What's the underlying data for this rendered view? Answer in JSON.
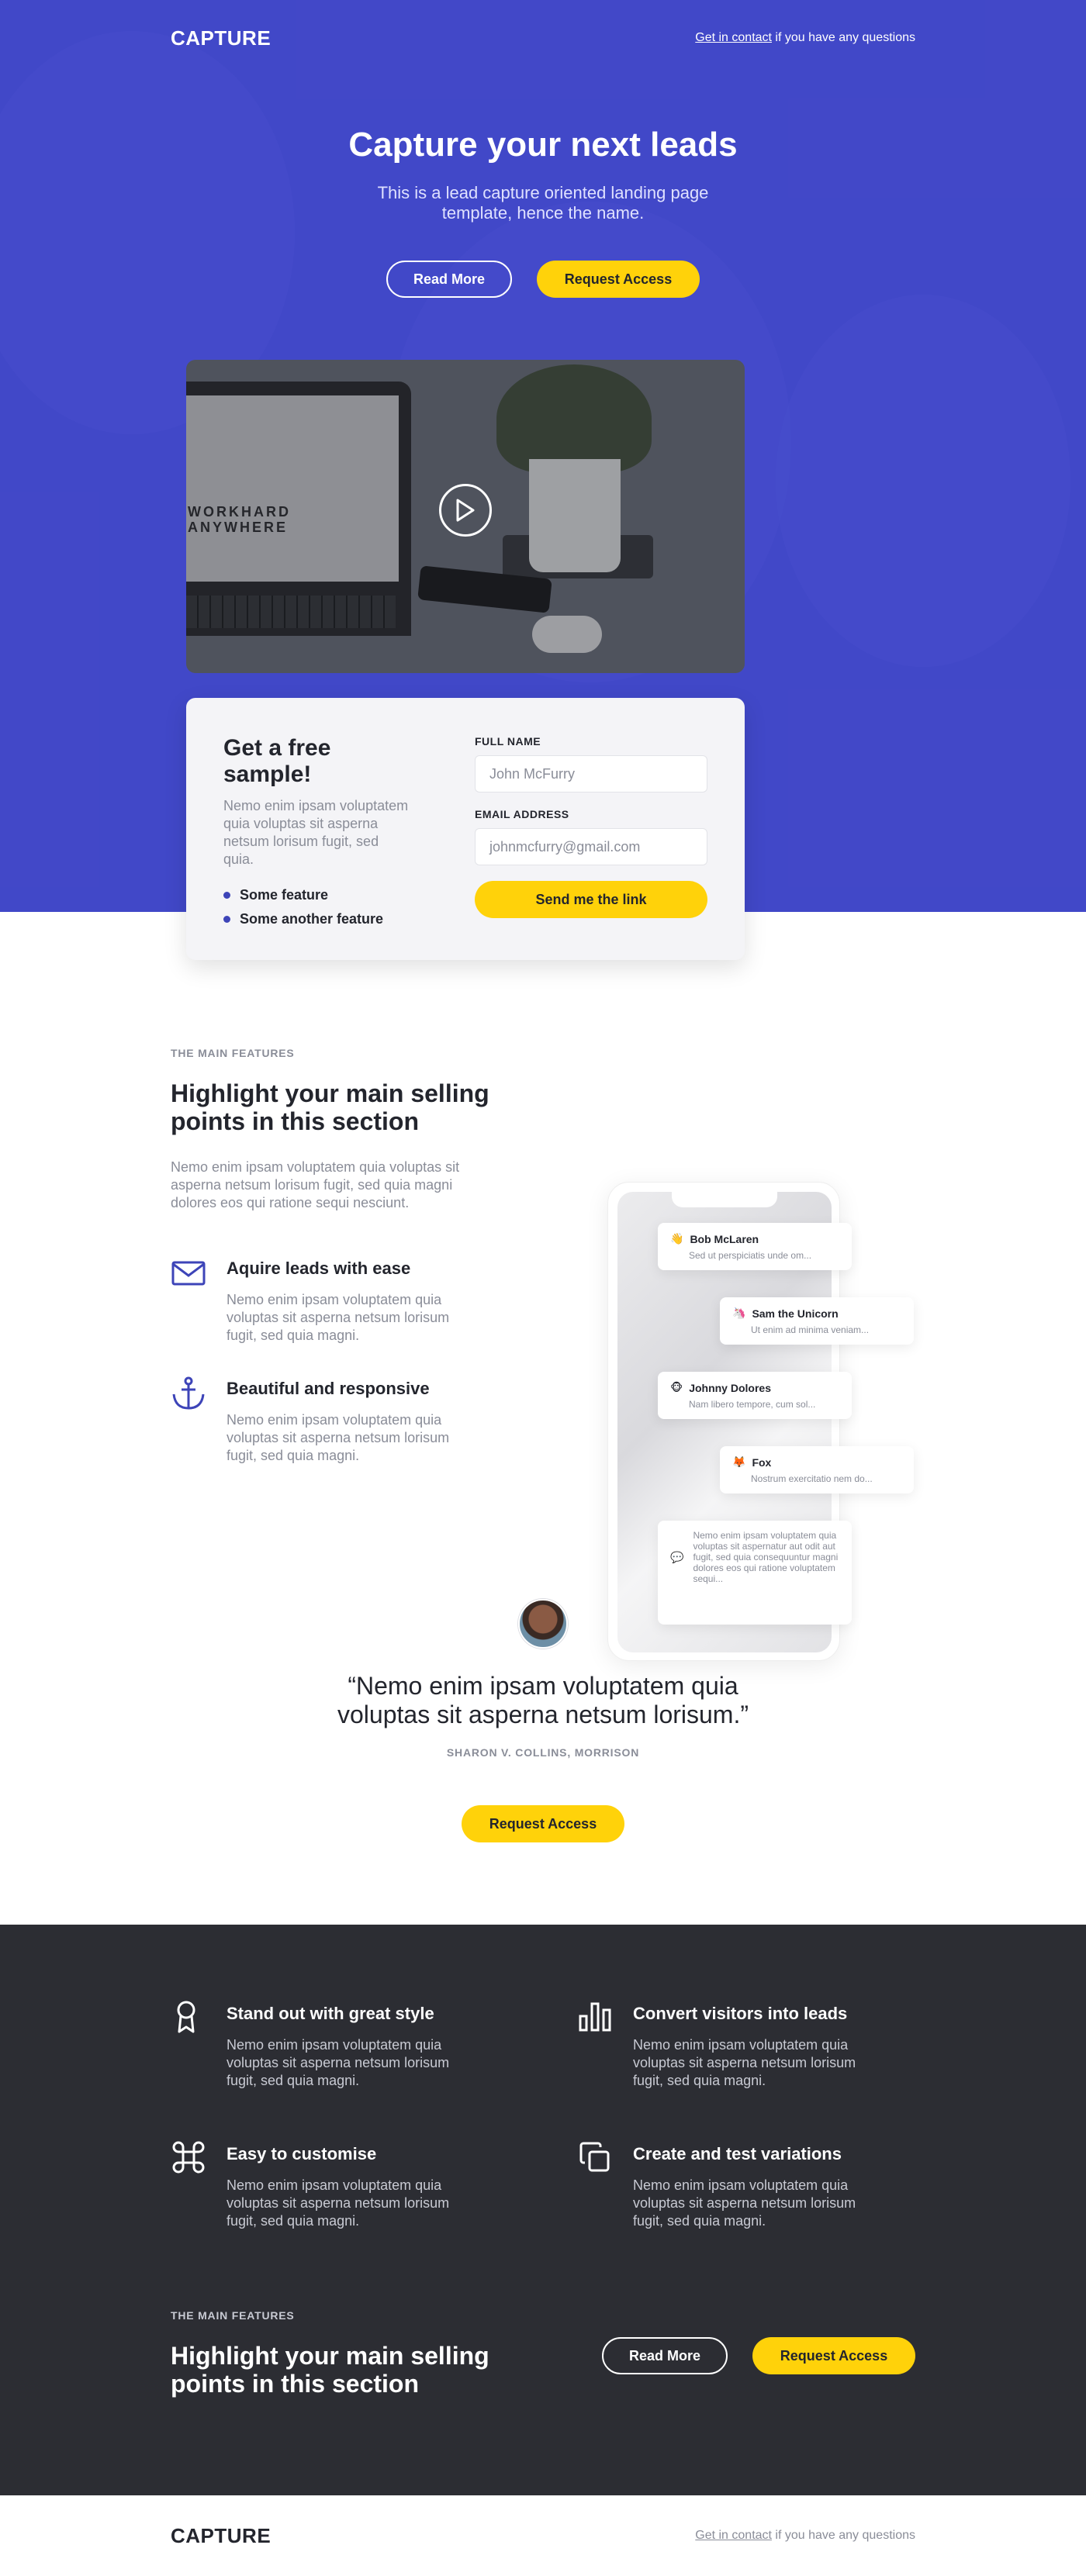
{
  "brand": "CAPTURE",
  "topbar": {
    "link": "Get in contact",
    "rest": " if you have any questions"
  },
  "hero": {
    "title": "Capture your next leads",
    "subtitle": "This is a lead capture oriented landing page template, hence the name.",
    "read_more": "Read More",
    "request_access": "Request Access"
  },
  "video": {
    "screen_text": "WORKHARD ANYWHERE",
    "play_icon": "play-icon"
  },
  "sample_form": {
    "title": "Get a free sample!",
    "text": "Nemo enim ipsam voluptatem quia voluptas sit asperna netsum lorisum fugit, sed quia.",
    "bullets": [
      "Some feature",
      "Some another feature"
    ],
    "name_label": "FULL NAME",
    "name_placeholder": "John McFurry",
    "email_label": "EMAIL ADDRESS",
    "email_placeholder": "johnmcfurry@gmail.com",
    "submit": "Send me the link"
  },
  "features": {
    "overline": "THE MAIN FEATURES",
    "title": "Highlight your main selling points in this section",
    "lead": "Nemo enim ipsam voluptatem quia voluptas sit asperna netsum lorisum fugit, sed quia magni dolores eos qui ratione sequi nesciunt.",
    "items": [
      {
        "icon": "envelope-icon",
        "title": "Aquire leads with ease",
        "text": "Nemo enim ipsam voluptatem quia voluptas sit asperna netsum lorisum fugit, sed quia magni."
      },
      {
        "icon": "anchor-icon",
        "title": "Beautiful and responsive",
        "text": "Nemo enim ipsam voluptatem quia voluptas sit asperna netsum lorisum fugit, sed quia magni."
      }
    ]
  },
  "chats": [
    {
      "emoji": "👋",
      "name": "Bob McLaren",
      "text": "Sed ut perspiciatis unde om..."
    },
    {
      "emoji": "🦄",
      "name": "Sam the Unicorn",
      "text": "Ut enim ad minima veniam..."
    },
    {
      "emoji": "🐵",
      "name": "Johnny Dolores",
      "text": "Nam libero tempore, cum sol..."
    },
    {
      "emoji": "🦊",
      "name": "Fox",
      "text": "Nostrum exercitatio nem do..."
    },
    {
      "emoji": "💬",
      "name": "",
      "text": "Nemo enim ipsam voluptatem quia voluptas sit aspernatur aut odit aut fugit, sed quia consequuntur magni dolores eos qui ratione voluptatem sequi..."
    }
  ],
  "testimonial": {
    "quote": "“Nemo enim ipsam voluptatem quia voluptas sit asperna netsum lorisum.”",
    "author": "SHARON V. COLLINS, MORRISON",
    "cta": "Request Access"
  },
  "dark": {
    "items": [
      {
        "icon": "award-icon",
        "title": "Stand out with great style",
        "text": "Nemo enim ipsam voluptatem quia voluptas sit asperna netsum lorisum fugit, sed quia magni."
      },
      {
        "icon": "bar-chart-icon",
        "title": "Convert visitors into leads",
        "text": "Nemo enim ipsam voluptatem quia voluptas sit asperna netsum lorisum fugit, sed quia magni."
      },
      {
        "icon": "command-icon",
        "title": "Easy to customise",
        "text": "Nemo enim ipsam voluptatem quia voluptas sit asperna netsum lorisum fugit, sed quia magni."
      },
      {
        "icon": "copy-icon",
        "title": "Create and test variations",
        "text": "Nemo enim ipsam voluptatem quia voluptas sit asperna netsum lorisum fugit, sed quia magni."
      }
    ],
    "overline": "THE MAIN FEATURES",
    "title": "Highlight your main selling points in this section",
    "read_more": "Read More",
    "request_access": "Request Access"
  },
  "footer": {
    "brand": "CAPTURE",
    "link": "Get in contact",
    "rest": " if you have any questions"
  },
  "colors": {
    "primary": "#4149c4",
    "accent": "#ffd20a",
    "dark": "#2c2d33",
    "text": "#23252d",
    "muted": "#8a8d98"
  }
}
